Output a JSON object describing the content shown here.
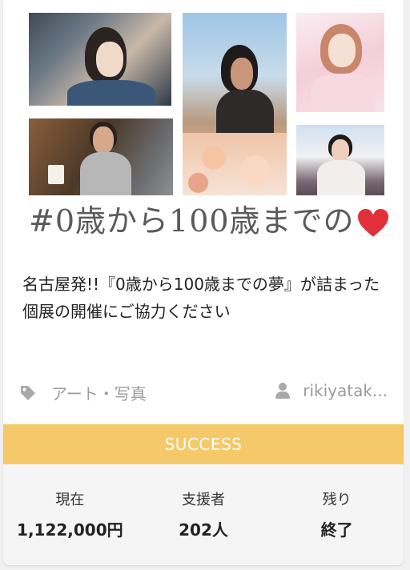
{
  "hero": {
    "caption": "#0歳から100歳までの",
    "heart_color": "#e0313a"
  },
  "project": {
    "title": "名古屋発!!『0歳から100歳までの夢』が詰まった個展の開催にご協力ください",
    "category": "アート・写真",
    "category_icon": "tag-icon",
    "author": "rikiyatak...",
    "author_icon": "user-icon"
  },
  "status": {
    "label": "SUCCESS",
    "color": "#f5c96a"
  },
  "stats": [
    {
      "label": "現在",
      "value": "1,122,000円"
    },
    {
      "label": "支援者",
      "value": "202人"
    },
    {
      "label": "残り",
      "value": "終了"
    }
  ]
}
